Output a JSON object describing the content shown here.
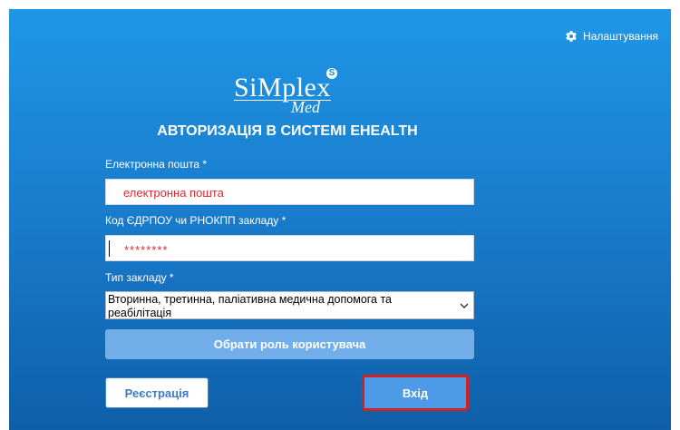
{
  "header": {
    "settings_label": "Налаштування",
    "settings_icon": "gear-icon"
  },
  "logo": {
    "main": "SiMplex",
    "sub": "Med",
    "badge": "S"
  },
  "form": {
    "title": "АВТОРИЗАЦІЯ В СИСТЕМІ EHEALTH",
    "email": {
      "label": "Електронна пошта *",
      "value": "електронна пошта"
    },
    "code": {
      "label": "Код ЄДРПОУ чи РНОКПП закладу *",
      "value": "********"
    },
    "facility_type": {
      "label": "Тип закладу *",
      "selected": "Вторинна, третинна, паліативна медична допомога та реабілітація"
    },
    "choose_role_button": "Обрати роль користувача",
    "register_button": "Реєстрація",
    "login_button": "Вхід"
  },
  "colors": {
    "background_top": "#1f97e6",
    "background_bottom": "#0f5fa8",
    "role_button": "#72aeea",
    "login_button": "#4d9ae6",
    "login_outline": "#d42020",
    "field_text": "#e0282a"
  }
}
